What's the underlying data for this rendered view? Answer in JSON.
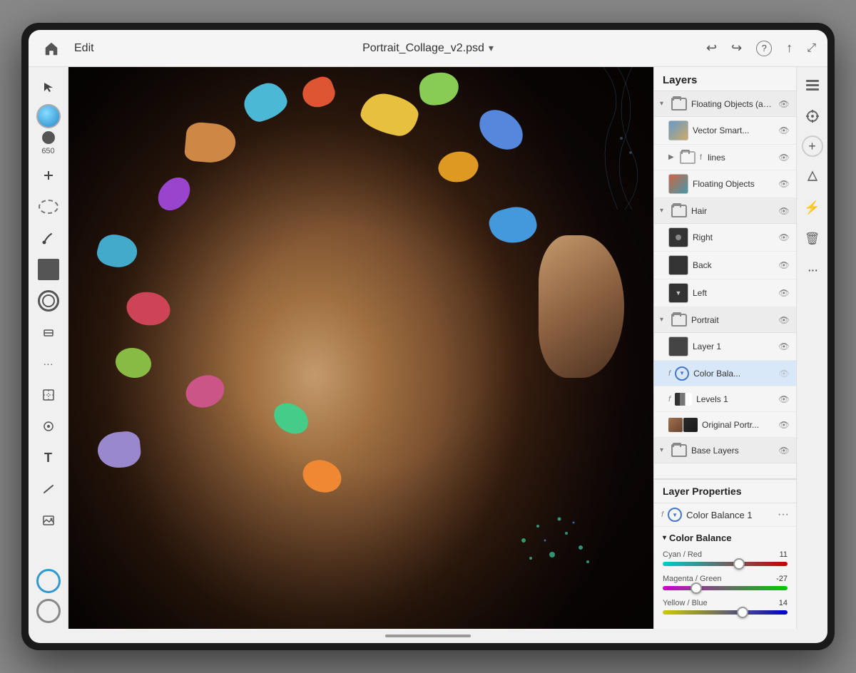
{
  "topbar": {
    "home_label": "⌂",
    "edit_label": "Edit",
    "file_title": "Portrait_Collage_v2.psd",
    "dropdown_icon": "▾",
    "undo_icon": "↩",
    "redo_icon": "↪",
    "help_icon": "?",
    "share_icon": "↑",
    "fullscreen_icon": "⛶"
  },
  "left_tools": {
    "select_arrow": "▲",
    "add_icon": "+",
    "lasso": "○",
    "brush": "✏",
    "eraser": "◻",
    "stamp": "◎",
    "transform": "⬜",
    "healing": "✦",
    "type": "T",
    "line": "/",
    "image": "▣",
    "more": "···"
  },
  "layers_panel": {
    "title": "Layers",
    "groups": [
      {
        "name": "Floating Objects (alway...",
        "expanded": true,
        "layers": [
          {
            "name": "Vector Smart...",
            "type": "vector",
            "visible": true
          },
          {
            "name": "lines",
            "type": "folder",
            "visible": true,
            "expanded": false
          },
          {
            "name": "Floating Objects",
            "type": "floating",
            "visible": true
          }
        ]
      },
      {
        "name": "Hair",
        "expanded": true,
        "layers": [
          {
            "name": "Right",
            "type": "hair",
            "visible": true,
            "dot": true
          },
          {
            "name": "Back",
            "type": "hair",
            "visible": true
          },
          {
            "name": "Left",
            "type": "hair",
            "visible": true,
            "chevron": true
          }
        ]
      },
      {
        "name": "Portrait",
        "expanded": true,
        "layers": [
          {
            "name": "Layer 1",
            "type": "dark",
            "visible": true
          },
          {
            "name": "Color Bala...",
            "type": "adjustment",
            "visible": true,
            "selected": true
          },
          {
            "name": "Levels 1",
            "type": "levels",
            "visible": true
          },
          {
            "name": "Original Portr...",
            "type": "photo",
            "visible": true
          }
        ]
      },
      {
        "name": "Base Layers",
        "expanded": false,
        "layers": []
      }
    ]
  },
  "layer_properties": {
    "title": "Layer Properties",
    "layer_name": "Color Balance 1",
    "more_icon": "···",
    "f_label": "f",
    "color_balance": {
      "section_title": "Color Balance",
      "sliders": [
        {
          "label": "Cyan / Red",
          "value": 11,
          "percent": 61,
          "type": "cyan-red"
        },
        {
          "label": "Magenta / Green",
          "value": -27,
          "percent": 27,
          "type": "magenta-green"
        },
        {
          "label": "Yellow / Blue",
          "value": 14,
          "percent": 64,
          "type": "yellow-blue"
        }
      ]
    }
  },
  "right_side_tools": {
    "layers_icon": "≡",
    "props_icon": "⚙",
    "add_layer": "+",
    "eraser": "◻",
    "lightning": "⚡",
    "trash": "🗑"
  }
}
